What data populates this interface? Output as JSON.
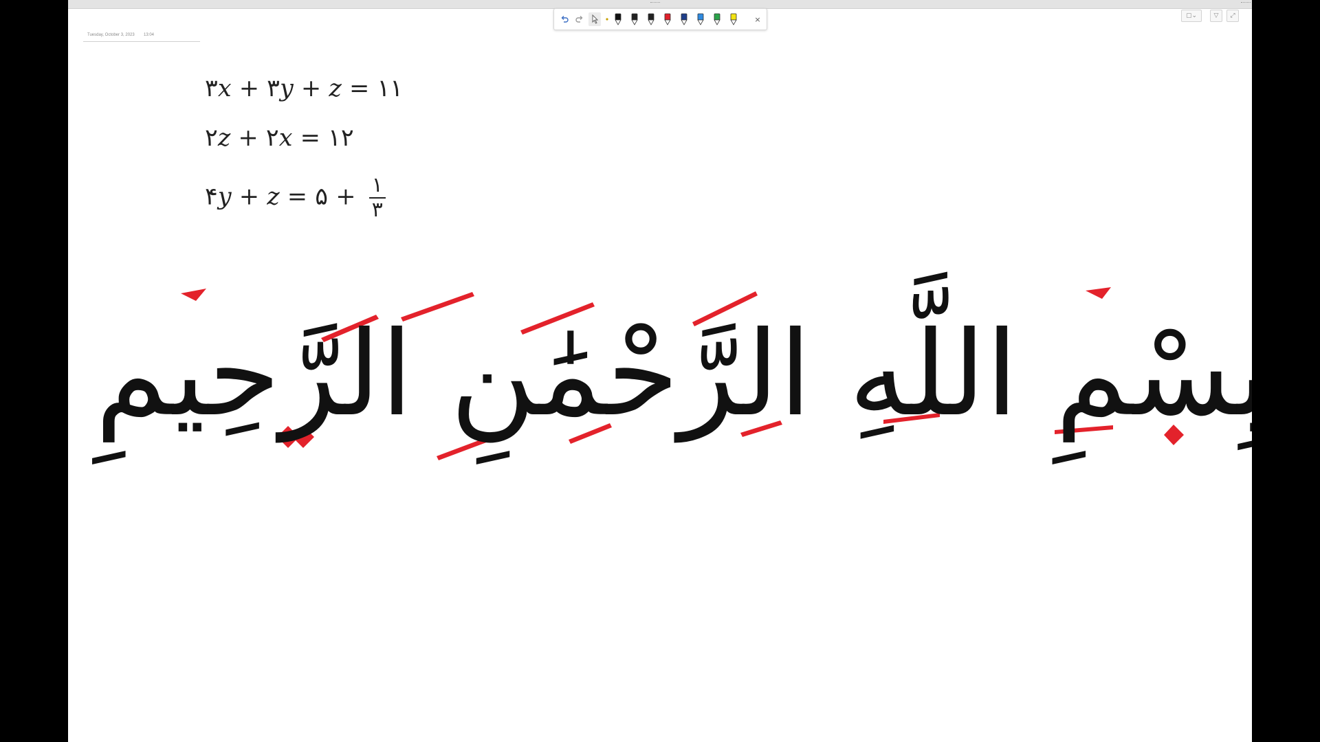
{
  "header": {
    "date": "Tuesday, October 3, 2023",
    "time": "13:04"
  },
  "toolbar": {
    "undo_icon": "undo-icon",
    "redo_icon": "redo-icon",
    "lasso_icon": "lasso-select-icon",
    "close_label": "×",
    "pens": [
      {
        "name": "black-marker",
        "color": "#111111"
      },
      {
        "name": "black-pen",
        "color": "#222222"
      },
      {
        "name": "black-pen-2",
        "color": "#222222"
      },
      {
        "name": "red-pen",
        "color": "#e0202a"
      },
      {
        "name": "dark-blue-pen",
        "color": "#1f3f8a"
      },
      {
        "name": "blue-pen",
        "color": "#2f8ae0"
      },
      {
        "name": "green-pen",
        "color": "#2aa44a"
      },
      {
        "name": "yellow-highlighter",
        "color": "#f2e313"
      }
    ]
  },
  "equations": {
    "eq1": {
      "c1": "٣",
      "v1": "x",
      "op1": "+",
      "c2": "٣",
      "v2": "y",
      "op2": "+",
      "v3": "z",
      "eq": "=",
      "rhs": "١١"
    },
    "eq2": {
      "c1": "٢",
      "v1": "z",
      "op1": "+",
      "c2": "٢",
      "v2": "x",
      "eq": "=",
      "rhs": "١٢"
    },
    "eq3": {
      "c1": "۴",
      "v1": "y",
      "op1": "+",
      "v2": "z",
      "eq": "=",
      "c3": "۵",
      "op2": "+",
      "num": "١",
      "den": "٣"
    }
  },
  "calligraphy": {
    "text": "بِسْمِ اللَّهِ الرَّحْمَٰنِ الرَّحِيمِ",
    "ink_color": "#111111",
    "accent_color": "#e3222b"
  }
}
